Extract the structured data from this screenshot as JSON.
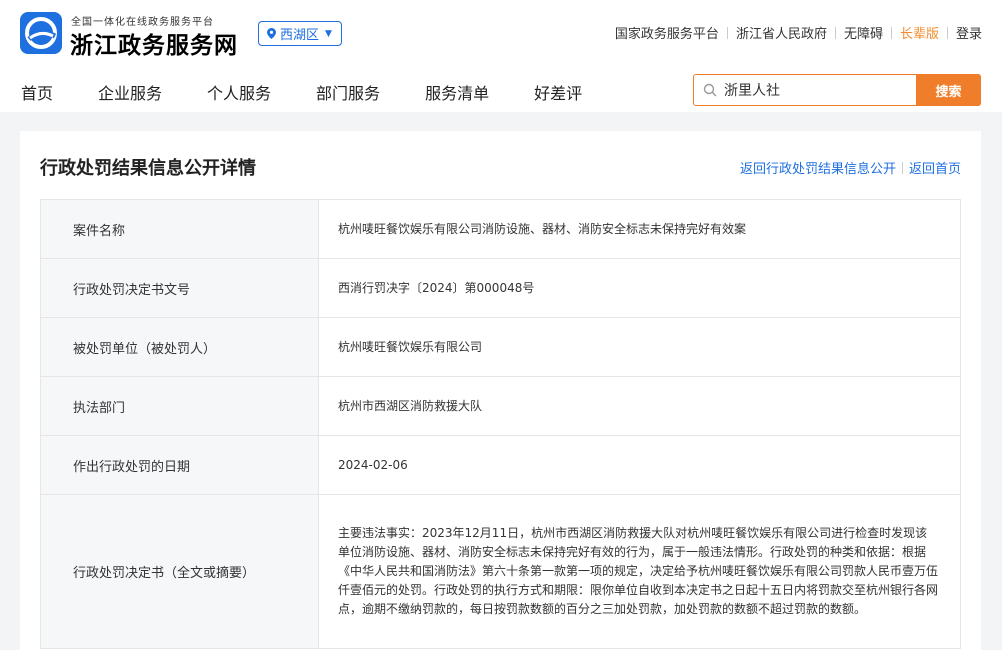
{
  "header": {
    "logo_subtitle": "全国一体化在线政务服务平台",
    "logo_title": "浙江政务服务网",
    "region": "西湖区",
    "top_links": [
      "国家政务服务平台",
      "浙江省人民政府",
      "无障碍",
      "长辈版",
      "登录"
    ],
    "nav": [
      "首页",
      "企业服务",
      "个人服务",
      "部门服务",
      "服务清单",
      "好差评"
    ],
    "search": {
      "value": "浙里人社",
      "button": "搜索"
    }
  },
  "detail": {
    "title": "行政处罚结果信息公开详情",
    "links": [
      "返回行政处罚结果信息公开",
      "返回首页"
    ],
    "rows": [
      {
        "label": "案件名称",
        "value": "杭州唛旺餐饮娱乐有限公司消防设施、器材、消防安全标志未保持完好有效案"
      },
      {
        "label": "行政处罚决定书文号",
        "value": "西消行罚决字〔2024〕第000048号"
      },
      {
        "label": "被处罚单位（被处罚人）",
        "value": "杭州唛旺餐饮娱乐有限公司"
      },
      {
        "label": "执法部门",
        "value": "杭州市西湖区消防救援大队"
      },
      {
        "label": "作出行政处罚的日期",
        "value": "2024-02-06"
      },
      {
        "label": "行政处罚决定书（全文或摘要）",
        "value": "主要违法事实：2023年12月11日，杭州市西湖区消防救援大队对杭州唛旺餐饮娱乐有限公司进行检查时发现该单位消防设施、器材、消防安全标志未保持完好有效的行为，属于一般违法情形。行政处罚的种类和依据：根据《中华人民共和国消防法》第六十条第一款第一项的规定，决定给予杭州唛旺餐饮娱乐有限公司罚款人民币壹万伍仟壹佰元的处罚。行政处罚的执行方式和期限：限你单位自收到本决定书之日起十五日内将罚款交至杭州银行各网点，逾期不缴纳罚款的，每日按罚款数额的百分之三加处罚款，加处罚款的数额不超过罚款的数额。"
      }
    ]
  },
  "colors": {
    "brand_blue": "#1f6fe0",
    "accent_orange": "#f07d2a"
  }
}
